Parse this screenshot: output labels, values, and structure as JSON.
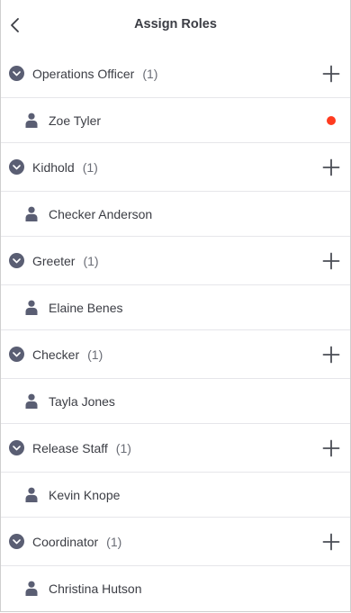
{
  "header": {
    "title": "Assign Roles",
    "back_icon": "chevron-left-icon"
  },
  "colors": {
    "accent_dark": "#5a5e73",
    "status_red": "#ff3b1f",
    "divider": "#e6e6ea"
  },
  "roles": [
    {
      "name": "Operations Officer",
      "count": "(1)",
      "member": "Zoe Tyler",
      "status_dot": true
    },
    {
      "name": "Kidhold",
      "count": "(1)",
      "member": "Checker Anderson",
      "status_dot": false
    },
    {
      "name": "Greeter",
      "count": "(1)",
      "member": "Elaine Benes",
      "status_dot": false
    },
    {
      "name": "Checker",
      "count": "(1)",
      "member": "Tayla Jones",
      "status_dot": false
    },
    {
      "name": "Release Staff",
      "count": "(1)",
      "member": "Kevin Knope",
      "status_dot": false
    },
    {
      "name": "Coordinator",
      "count": "(1)",
      "member": "Christina Hutson",
      "status_dot": false
    }
  ]
}
